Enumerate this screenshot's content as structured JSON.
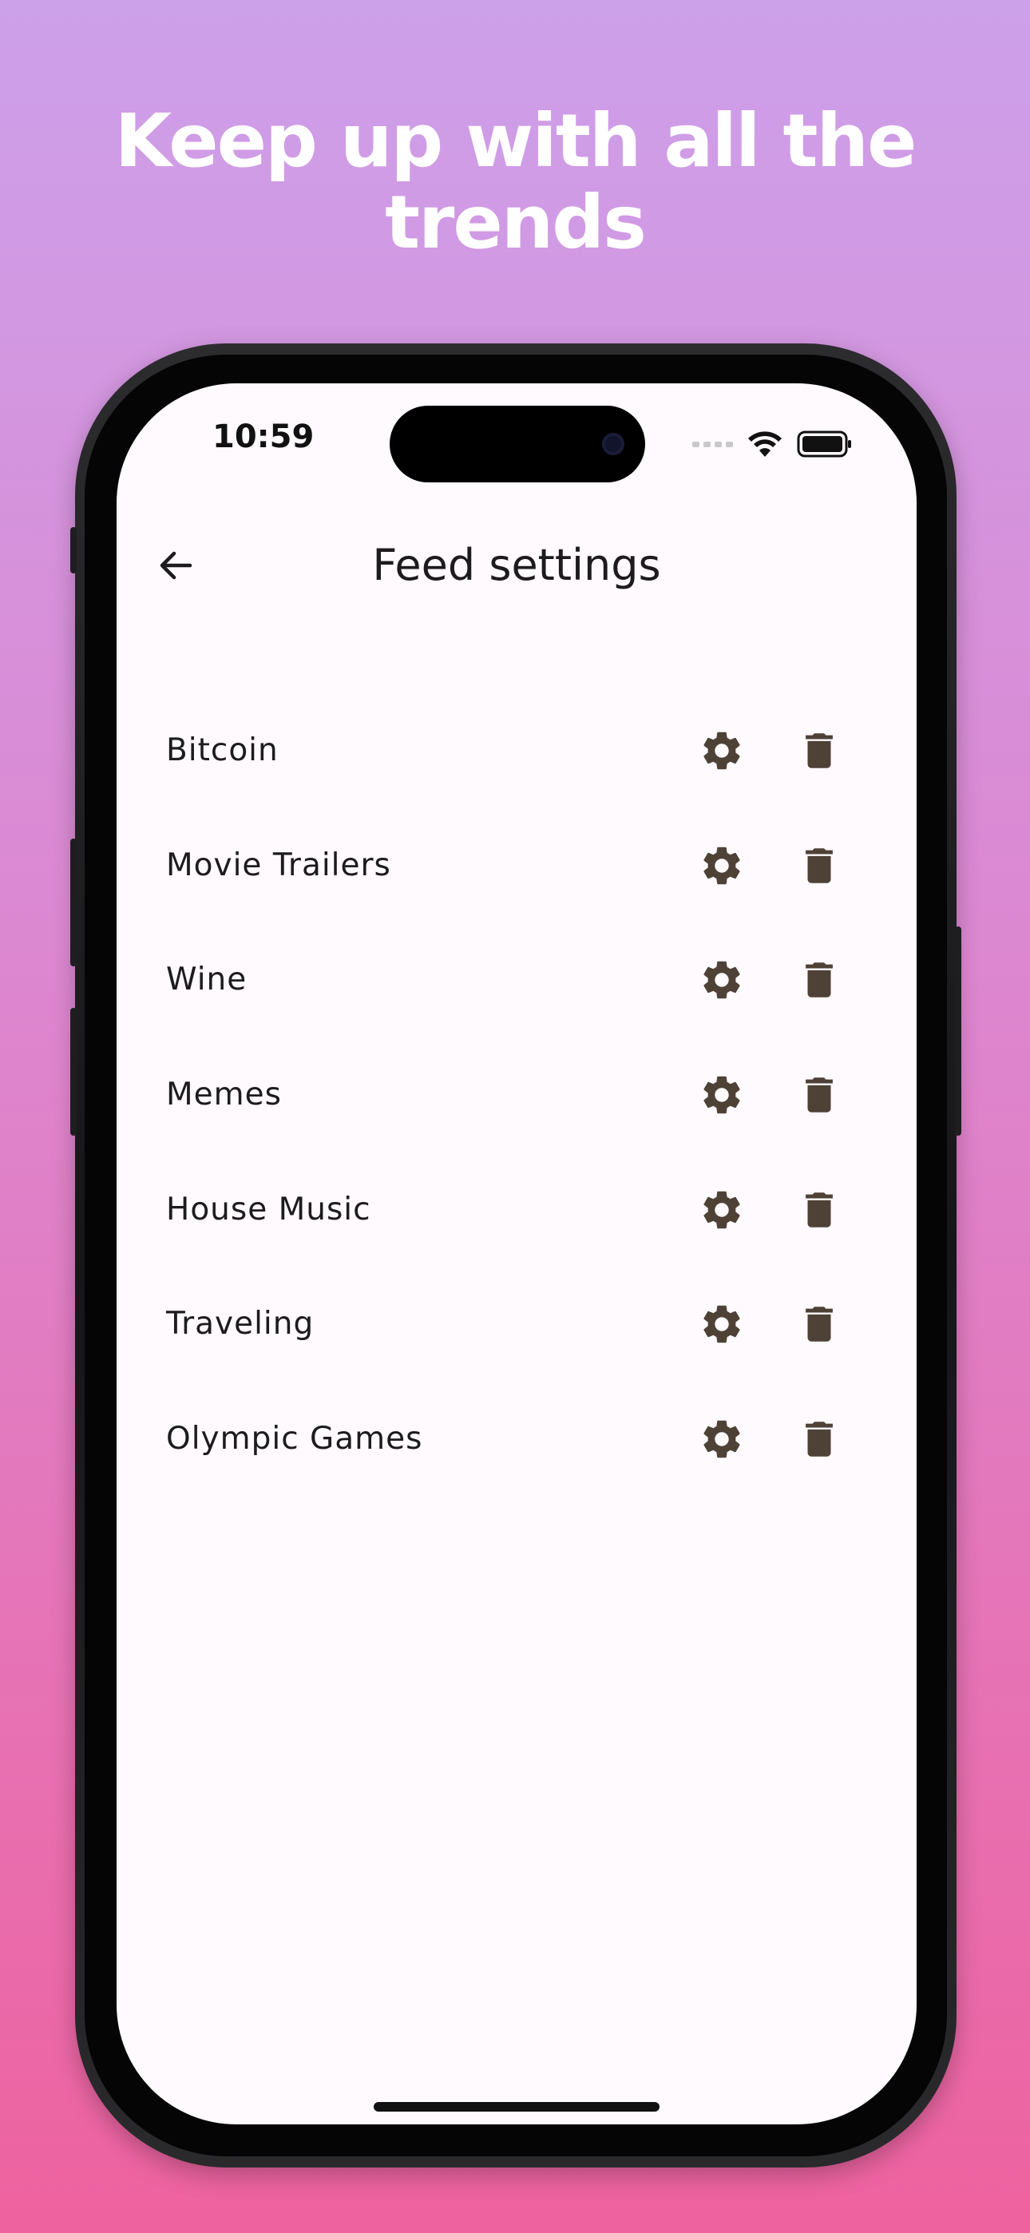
{
  "headline": {
    "line1": "Keep up with all the",
    "line2": "trends"
  },
  "status_bar": {
    "time": "10:59"
  },
  "topbar": {
    "title": "Feed settings",
    "back_icon": "arrow-left-icon"
  },
  "feeds": [
    {
      "label": "Bitcoin",
      "settings_icon": "gear-icon",
      "delete_icon": "trash-icon"
    },
    {
      "label": "Movie Trailers",
      "settings_icon": "gear-icon",
      "delete_icon": "trash-icon"
    },
    {
      "label": "Wine",
      "settings_icon": "gear-icon",
      "delete_icon": "trash-icon"
    },
    {
      "label": "Memes",
      "settings_icon": "gear-icon",
      "delete_icon": "trash-icon"
    },
    {
      "label": "House Music",
      "settings_icon": "gear-icon",
      "delete_icon": "trash-icon"
    },
    {
      "label": "Traveling",
      "settings_icon": "gear-icon",
      "delete_icon": "trash-icon"
    },
    {
      "label": "Olympic Games",
      "settings_icon": "gear-icon",
      "delete_icon": "trash-icon"
    }
  ],
  "colors": {
    "background_top": "#cda0ea",
    "background_bottom": "#ee629f",
    "screen": "#fffafd",
    "text": "#1d1b1e",
    "icon": "#4e4237"
  }
}
